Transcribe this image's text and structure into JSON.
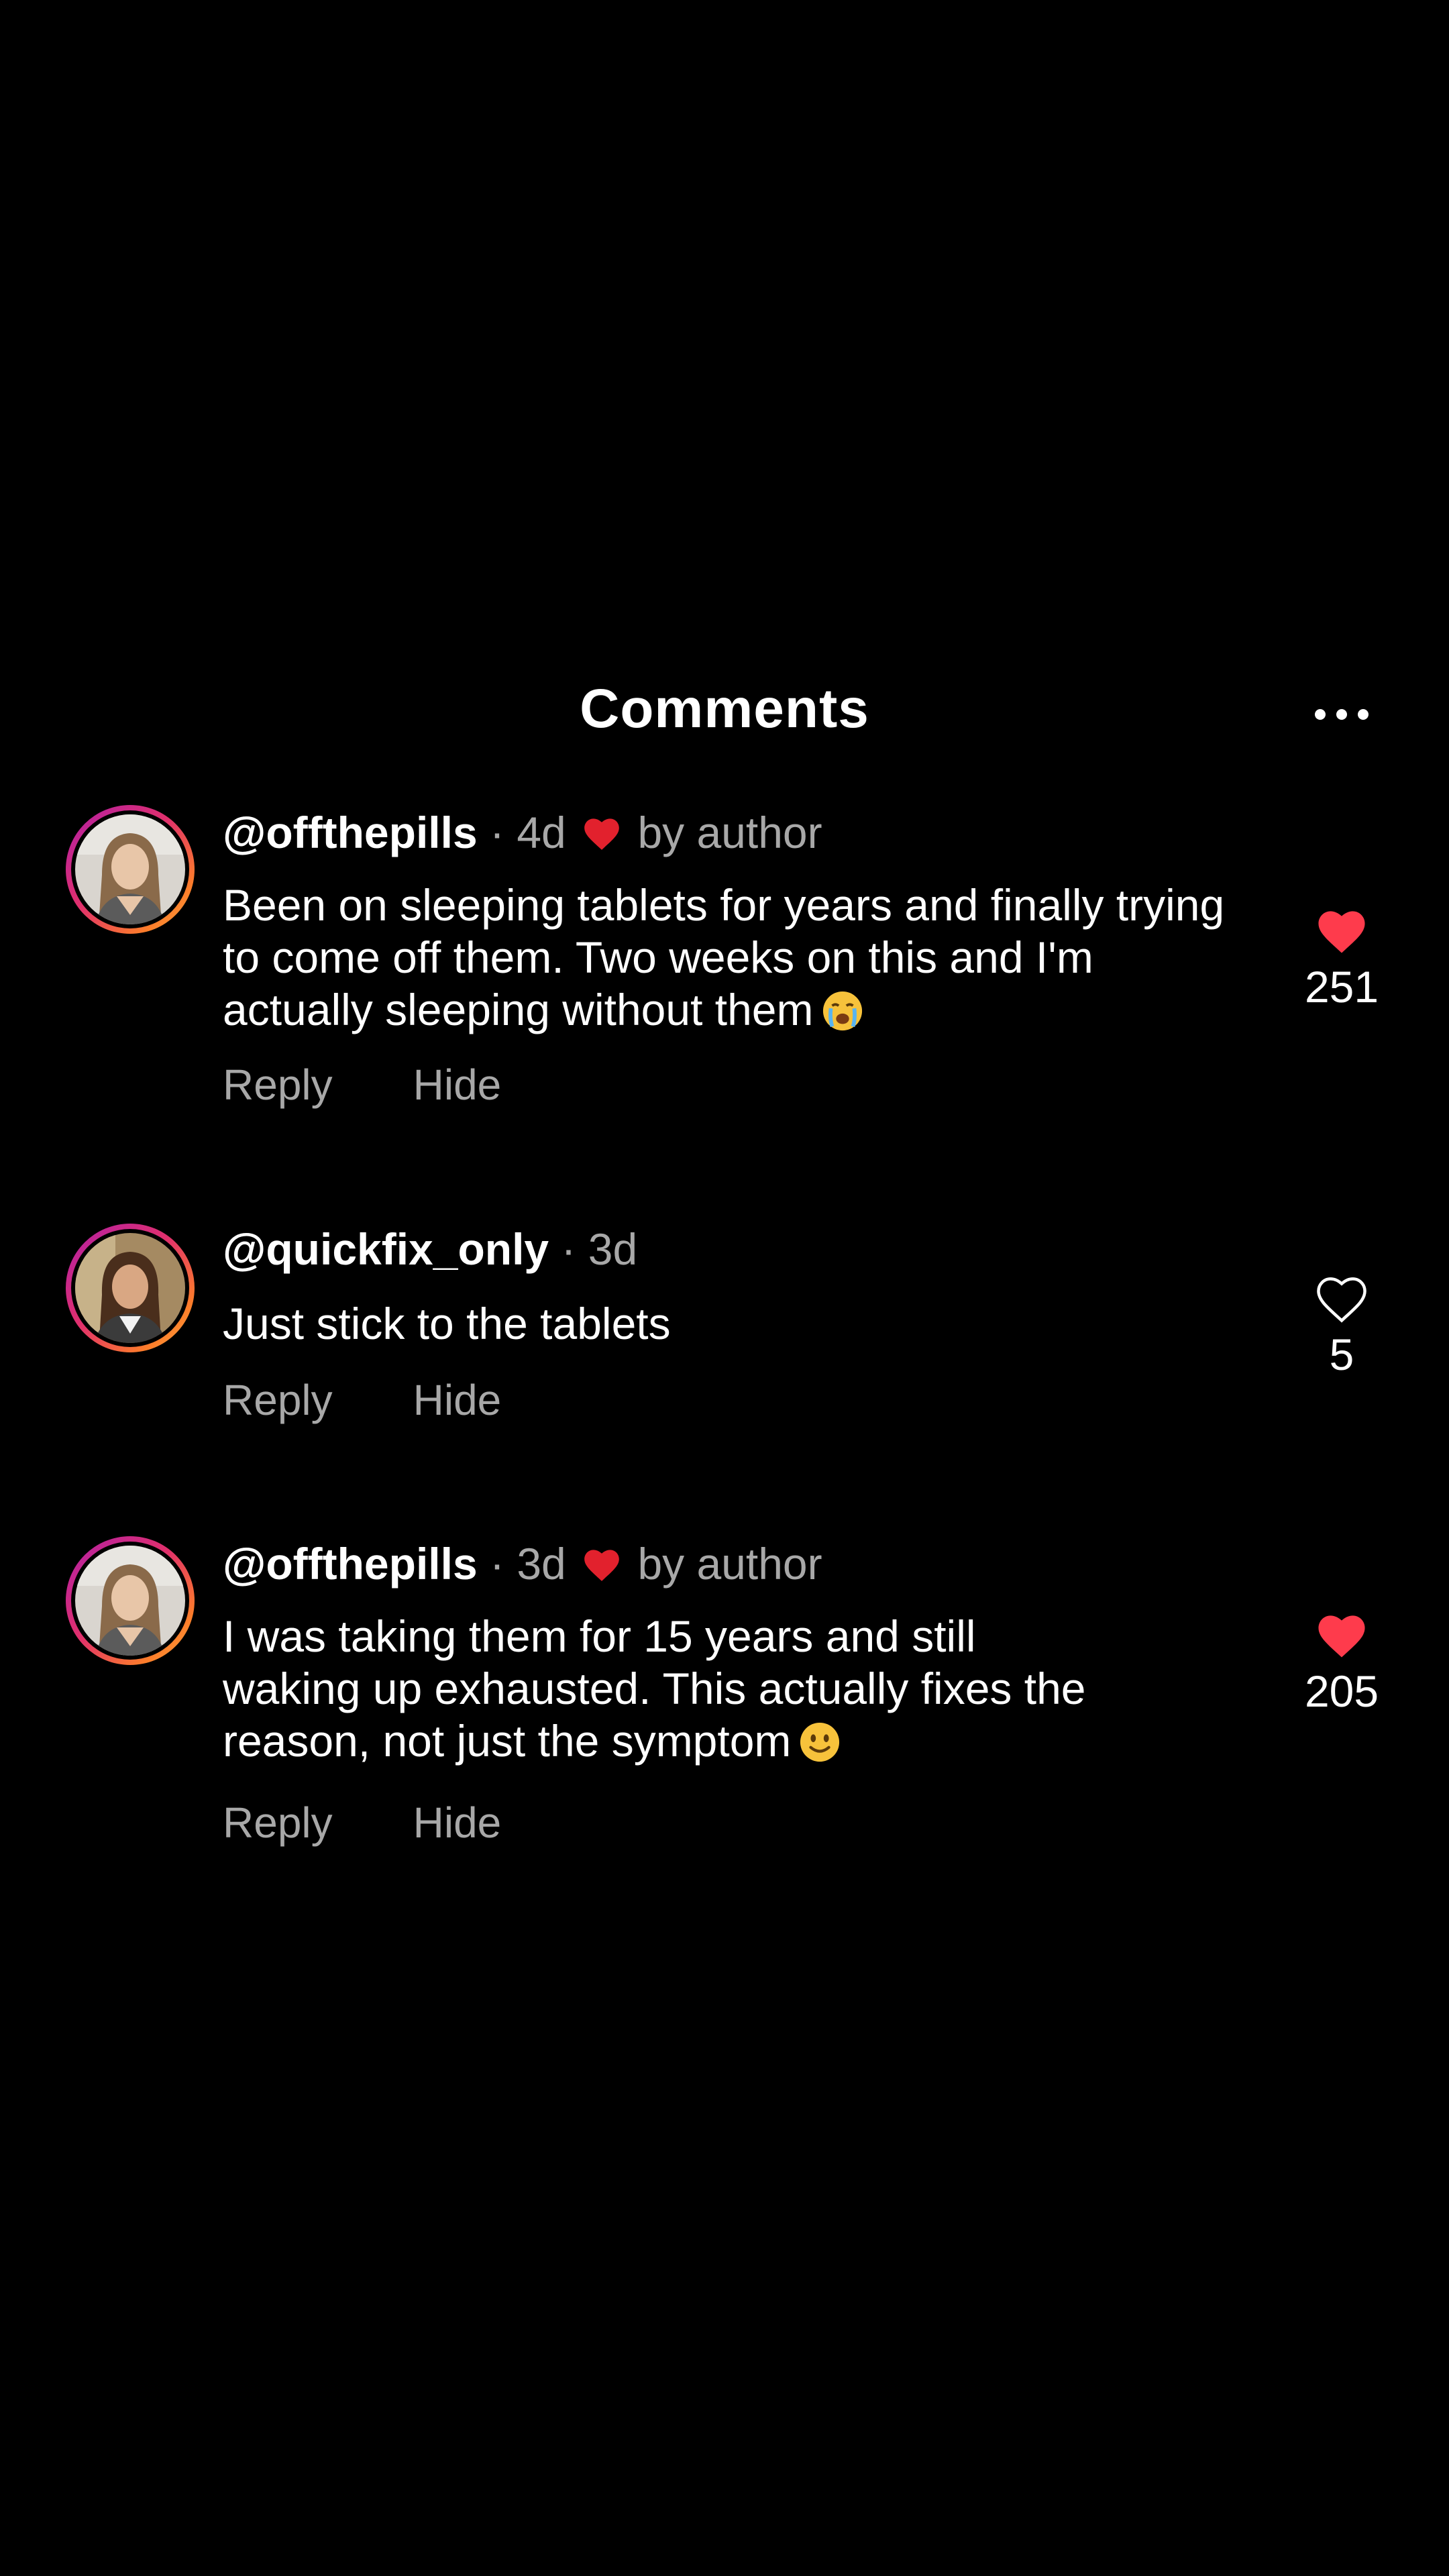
{
  "header": {
    "title": "Comments",
    "more_icon": "more-horizontal-icon"
  },
  "comments": [
    {
      "username": "@offthepills",
      "time": "· 4d",
      "liked_by_author": true,
      "author_label": "by author",
      "text": "Been on sleeping tablets for years and finally trying to come off them. Two weeks on this and I'm actually sleeping without them",
      "emoji": "😭",
      "reply_label": "Reply",
      "hide_label": "Hide",
      "likes": "251",
      "liked": true
    },
    {
      "username": "@quickfix_only",
      "time": "· 3d",
      "liked_by_author": false,
      "author_label": "",
      "text": "Just stick to the tablets",
      "emoji": "",
      "reply_label": "Reply",
      "hide_label": "Hide",
      "likes": "5",
      "liked": false
    },
    {
      "username": "@offthepills",
      "time": "· 3d",
      "liked_by_author": true,
      "author_label": "by author",
      "text": "I was taking them for 15 years and still waking up exhausted. This actually fixes the reason, not just the symptom",
      "emoji": "🙂",
      "reply_label": "Reply",
      "hide_label": "Hide",
      "likes": "205",
      "liked": true
    }
  ],
  "colors": {
    "background": "#000000",
    "heart_red": "#fe3b4c",
    "secondary_text": "#a8a8a8"
  }
}
